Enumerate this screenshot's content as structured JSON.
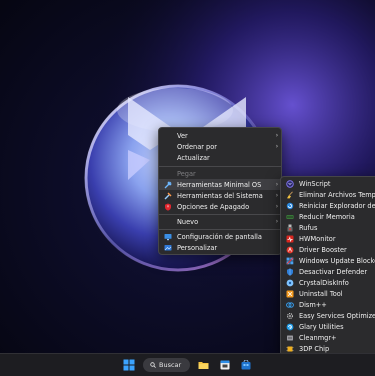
{
  "context_menu": {
    "items": [
      {
        "label": "Ver",
        "arrow": true
      },
      {
        "label": "Ordenar por",
        "arrow": true
      },
      {
        "label": "Actualizar",
        "arrow": false
      },
      {
        "label": "Pegar",
        "arrow": false,
        "disabled": true
      },
      {
        "label": "Herramientas Minimal OS",
        "arrow": true,
        "highlighted": true,
        "icon": "tools-icon"
      },
      {
        "label": "Herramientas del Sistema",
        "arrow": true,
        "icon": "system-tools-icon"
      },
      {
        "label": "Opciones de Apagado",
        "arrow": true,
        "icon": "shield-power-icon"
      },
      {
        "label": "Nuevo",
        "arrow": true
      },
      {
        "label": "Configuración de pantalla",
        "arrow": false,
        "icon": "display-settings-icon"
      },
      {
        "label": "Personalizar",
        "arrow": false,
        "icon": "personalize-icon"
      }
    ]
  },
  "submenu": {
    "items": [
      {
        "label": "WinScript",
        "icon": "winscript-icon"
      },
      {
        "label": "Eliminar Archivos Temporales",
        "icon": "broom-icon"
      },
      {
        "label": "Reiniciar Explorador de Archivos",
        "icon": "explorer-restart-icon"
      },
      {
        "label": "Reducir Memoria",
        "icon": "memory-icon"
      },
      {
        "label": "Rufus",
        "icon": "rufus-icon"
      },
      {
        "label": "HWMonitor",
        "icon": "hwmonitor-icon"
      },
      {
        "label": "Driver Booster",
        "icon": "driver-booster-icon"
      },
      {
        "label": "Windows Update Blocker",
        "icon": "update-blocker-icon"
      },
      {
        "label": "Desactivar Defender",
        "icon": "defender-icon"
      },
      {
        "label": "CrystalDiskInfo",
        "icon": "crystaldisk-icon"
      },
      {
        "label": "Uninstall Tool",
        "icon": "uninstall-tool-icon"
      },
      {
        "label": "Dism++",
        "icon": "dism-icon"
      },
      {
        "label": "Easy Services Optimizer",
        "icon": "services-optimizer-icon"
      },
      {
        "label": "Glary Utilities",
        "icon": "glary-icon"
      },
      {
        "label": "Cleanmgr+",
        "icon": "cleanmgr-icon"
      },
      {
        "label": "3DP Chip",
        "icon": "3dp-chip-icon"
      }
    ]
  },
  "taskbar": {
    "search_label": "Buscar",
    "apps": [
      "start-icon",
      "search-icon",
      "file-explorer-icon",
      "calendar-app-icon",
      "store-icon"
    ]
  },
  "colors": {
    "menu_bg": "#2b2b2d",
    "highlight": "#3f3f43",
    "taskbar_bg": "#1d1d21",
    "accent_blue": "#2f8fe8"
  }
}
